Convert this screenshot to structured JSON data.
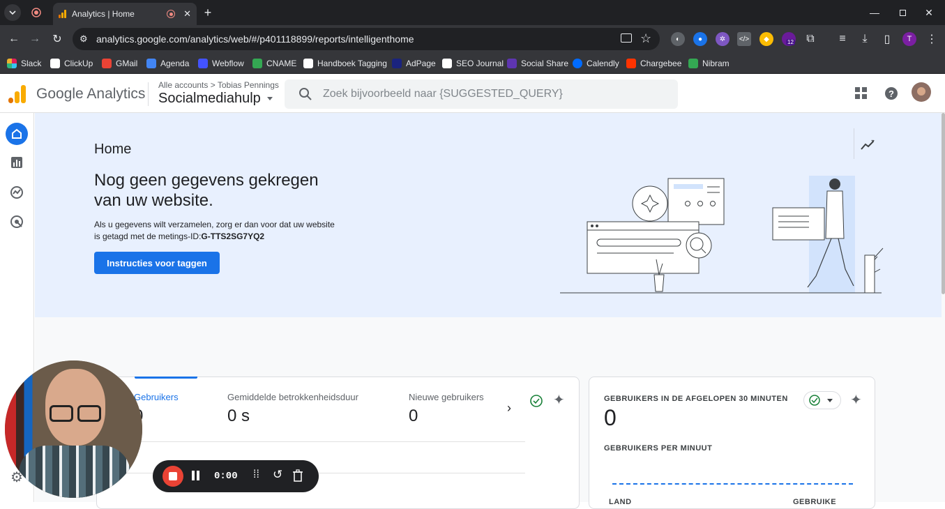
{
  "browser": {
    "tab_title": "Analytics | Home",
    "url": "analytics.google.com/analytics/web/#/p401118899/reports/intelligenthome",
    "extension_badge": "12",
    "profile_initial": "T",
    "bookmarks": [
      "Slack",
      "ClickUp",
      "GMail",
      "Agenda",
      "Webflow",
      "CNAME",
      "Handboek Tagging",
      "AdPage",
      "SEO Journal",
      "Social Share",
      "Calendly",
      "Chargebee",
      "Nibram"
    ]
  },
  "header": {
    "product_name": "Google Analytics",
    "breadcrumb_root": "Alle accounts",
    "breadcrumb_account": "Tobias Pennings",
    "property": "Socialmediahulp",
    "search_placeholder": "Zoek bijvoorbeeld naar {SUGGESTED_QUERY}"
  },
  "hero": {
    "page_title": "Home",
    "headline": "Nog geen gegevens gekregen van uw website.",
    "body_text": "Als u gegevens wilt verzamelen, zorg er dan voor dat uw website is getagd met de metings-ID:",
    "measurement_id": "G-TTS2SG7YQ2",
    "cta_label": "Instructies voor taggen"
  },
  "metrics_card": {
    "metrics": [
      {
        "label": "Gebruikers",
        "value": "0"
      },
      {
        "label": "Gemiddelde betrokkenheidsduur",
        "value": "0 s"
      },
      {
        "label": "Nieuwe gebruikers",
        "value": "0"
      }
    ]
  },
  "realtime_card": {
    "title": "GEBRUIKERS IN DE AFGELOPEN 30 MINUTEN",
    "value": "0",
    "subtitle": "GEBRUIKERS PER MINUUT",
    "col_left": "LAND",
    "col_right": "GEBRUIKE"
  },
  "recorder": {
    "time": "0:00"
  },
  "colors": {
    "accent_blue": "#1a73e8",
    "hero_bg": "#e8f0fe",
    "success_green": "#188038"
  }
}
